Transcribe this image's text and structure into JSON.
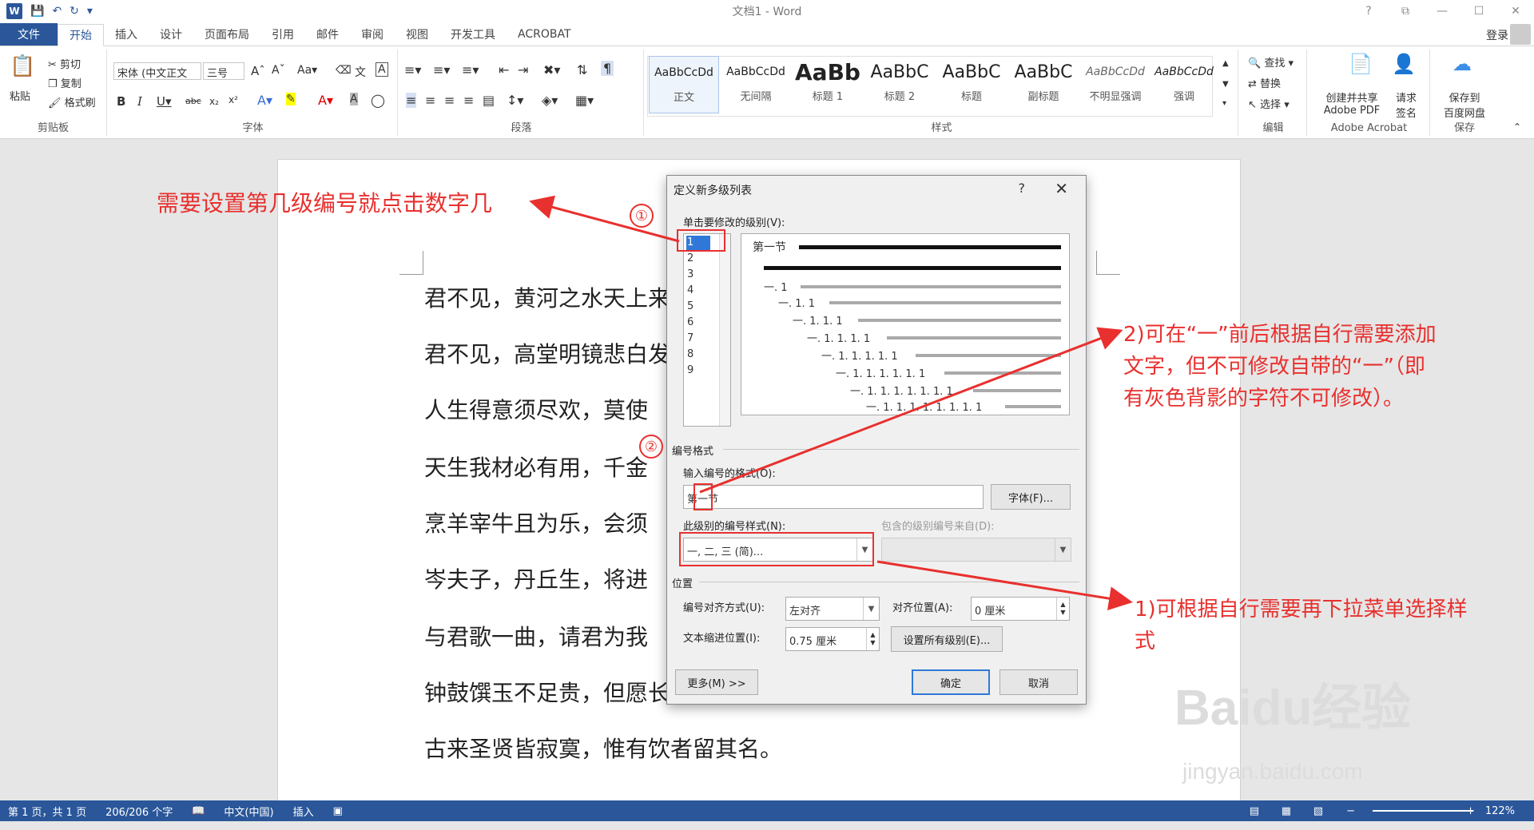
{
  "window": {
    "title": "文档1 - Word",
    "help": "?",
    "restore": "⧉",
    "minimize": "—",
    "maximize": "☐",
    "close": "✕"
  },
  "tabs": [
    "文件",
    "开始",
    "插入",
    "设计",
    "页面布局",
    "引用",
    "邮件",
    "审阅",
    "视图",
    "开发工具",
    "ACROBAT"
  ],
  "account": {
    "login": "登录"
  },
  "ribbon": {
    "clipboard": {
      "paste": "粘贴",
      "cut": "剪切",
      "copy": "复制",
      "painter": "格式刷",
      "label": "剪贴板"
    },
    "font": {
      "name": "宋体 (中文正文",
      "size": "三号",
      "label": "字体"
    },
    "paragraph": {
      "label": "段落"
    },
    "styles": {
      "label": "样式",
      "items": [
        {
          "sample": "AaBbCcDd",
          "name": "正文"
        },
        {
          "sample": "AaBbCcDd",
          "name": "无间隔"
        },
        {
          "sample": "AaBb",
          "name": "标题 1"
        },
        {
          "sample": "AaBbC",
          "name": "标题 2"
        },
        {
          "sample": "AaBbC",
          "name": "标题"
        },
        {
          "sample": "AaBbC",
          "name": "副标题"
        },
        {
          "sample": "AaBbCcDd",
          "name": "不明显强调"
        },
        {
          "sample": "AaBbCcDd",
          "name": "强调"
        }
      ]
    },
    "editing": {
      "find": "查找",
      "replace": "替换",
      "select": "选择",
      "label": "编辑"
    },
    "acrobat": {
      "create_pdf_line1": "创建并共享",
      "create_pdf_line2": "Adobe PDF",
      "sign_line1": "请求",
      "sign_line2": "签名",
      "label": "Adobe Acrobat"
    },
    "save": {
      "line1": "保存到",
      "line2": "百度网盘",
      "label": "保存"
    }
  },
  "document": {
    "lines": [
      "君不见，黄河之水天上来",
      "君不见，高堂明镜悲白发",
      "人生得意须尽欢，莫使",
      "天生我材必有用，千金",
      "烹羊宰牛且为乐，会须",
      "岑夫子，丹丘生，将进",
      "与君歌一曲，请君为我",
      "钟鼓馔玉不足贵，但愿长醉不复醒。",
      "古来圣贤皆寂寞，惟有饮者留其名。"
    ]
  },
  "dialog": {
    "title": "定义新多级列表",
    "help": "?",
    "close": "✕",
    "level_label": "单击要修改的级别(V):",
    "levels": [
      "1",
      "2",
      "3",
      "4",
      "5",
      "6",
      "7",
      "8",
      "9"
    ],
    "preview": {
      "heading": "第一节",
      "rows": [
        "一. 1",
        "一. 1. 1",
        "一. 1. 1. 1",
        "一. 1. 1. 1. 1",
        "一. 1. 1. 1. 1. 1",
        "一. 1. 1. 1. 1. 1. 1",
        "一. 1. 1. 1. 1. 1. 1. 1",
        "一. 1. 1. 1. 1. 1. 1. 1. 1"
      ]
    },
    "number_format_section": "编号格式",
    "enter_format_label": "输入编号的格式(O):",
    "enter_format_value": "第一节",
    "font_button": "字体(F)...",
    "style_label": "此级别的编号样式(N):",
    "style_value": "一, 二, 三 (简)...",
    "include_label": "包含的级别编号来自(D):",
    "position_section": "位置",
    "align_label": "编号对齐方式(U):",
    "align_value": "左对齐",
    "align_at_label": "对齐位置(A):",
    "align_at_value": "0 厘米",
    "indent_label": "文本缩进位置(I):",
    "indent_value": "0.75 厘米",
    "set_all_button": "设置所有级别(E)...",
    "more_button": "更多(M) >>",
    "ok_button": "确定",
    "cancel_button": "取消"
  },
  "annotations": {
    "a1": "需要设置第几级编号就点击数字几",
    "c1": "①",
    "c2": "②",
    "a2_line1": "2)可在“一”前后根据自行需要添加",
    "a2_line2": "文字，但不可修改自带的“一”（即",
    "a2_line3": "有灰色背影的字符不可修改）。",
    "a3_line1": "1)可根据自行需要再下拉菜单选择样",
    "a3_line2": "式",
    "color": "#e8302e"
  },
  "status": {
    "page": "第 1 页，共 1 页",
    "words": "206/206 个字",
    "lang": "中文(中国)",
    "mode": "插入",
    "zoom": "122%"
  },
  "watermark": {
    "brand": "Baidu经验",
    "url": "jingyan.baidu.com"
  }
}
